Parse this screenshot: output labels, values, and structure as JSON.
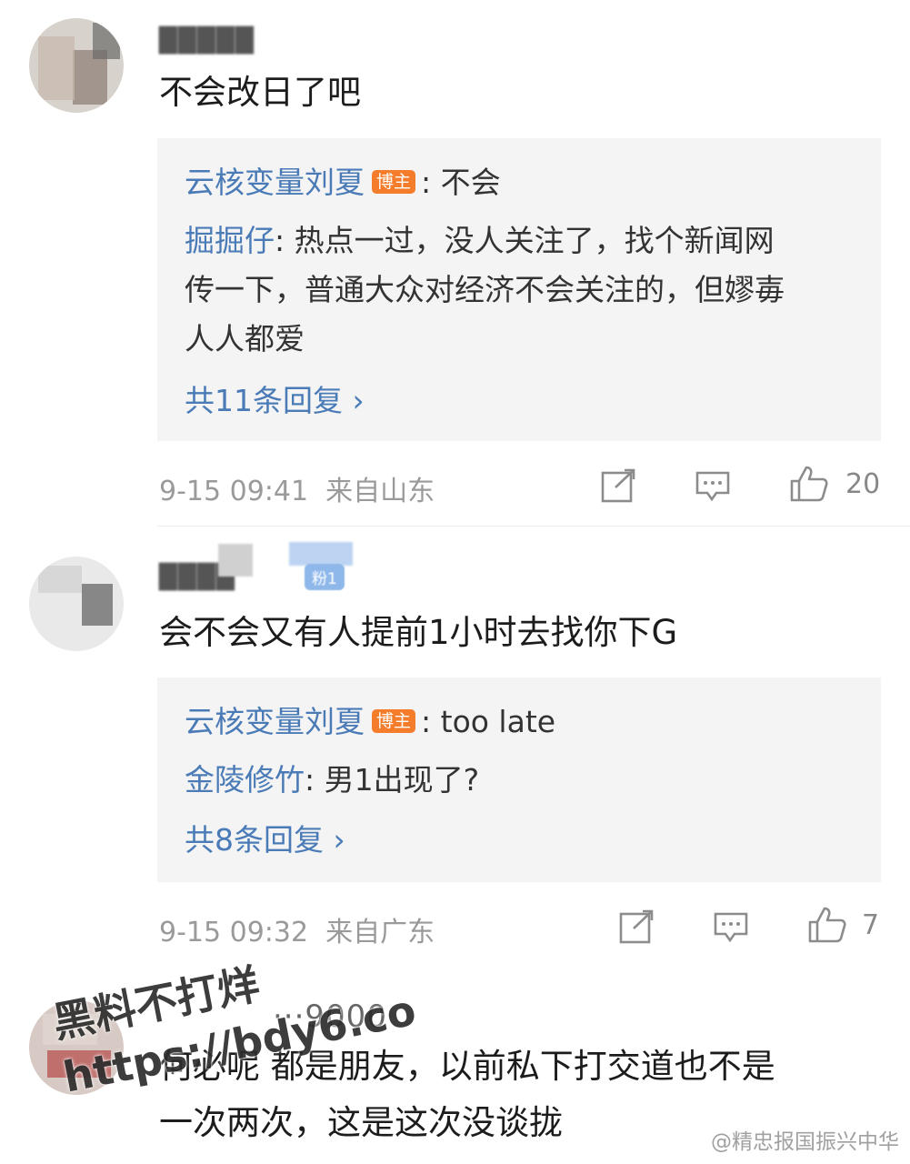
{
  "comments": [
    {
      "text": "不会改日了吧",
      "reply_box": {
        "lines": [
          {
            "name": "云核变量刘夏",
            "badge": "博主",
            "text": ": 不会"
          },
          {
            "name": "掘掘仔",
            "text": ": 热点一过，没人关注了，找个新闻网"
          },
          {
            "text": "传一下，普通大众对经济不会关注的，但嫪毐"
          },
          {
            "text": "人人都爱"
          }
        ],
        "more": "共11条回复 ›"
      },
      "time": "9-15 09:41",
      "location": "来自山东",
      "likes": "20"
    },
    {
      "fans_badge": "粉1",
      "text": "会不会又有人提前1小时去找你下G",
      "reply_box": {
        "lines": [
          {
            "name": "云核变量刘夏",
            "badge": "博主",
            "text": ": too late"
          },
          {
            "name": "金陵修竹",
            "text": ": 男1出现了?"
          }
        ],
        "more": "共8条回复 ›"
      },
      "time": "9-15 09:32",
      "location": "来自广东",
      "likes": "7"
    },
    {
      "username": "···9000",
      "text_line1": "何必呢 都是朋友，以前私下打交道也不是",
      "text_line2": "一次两次，这是这次没谈拢"
    }
  ],
  "watermark": {
    "line1": "黑料不打烊",
    "line2": "https://bdy6.co"
  },
  "credit": "@精忠报国振兴中华",
  "icons": [
    "share-icon",
    "comment-icon",
    "like-icon"
  ]
}
